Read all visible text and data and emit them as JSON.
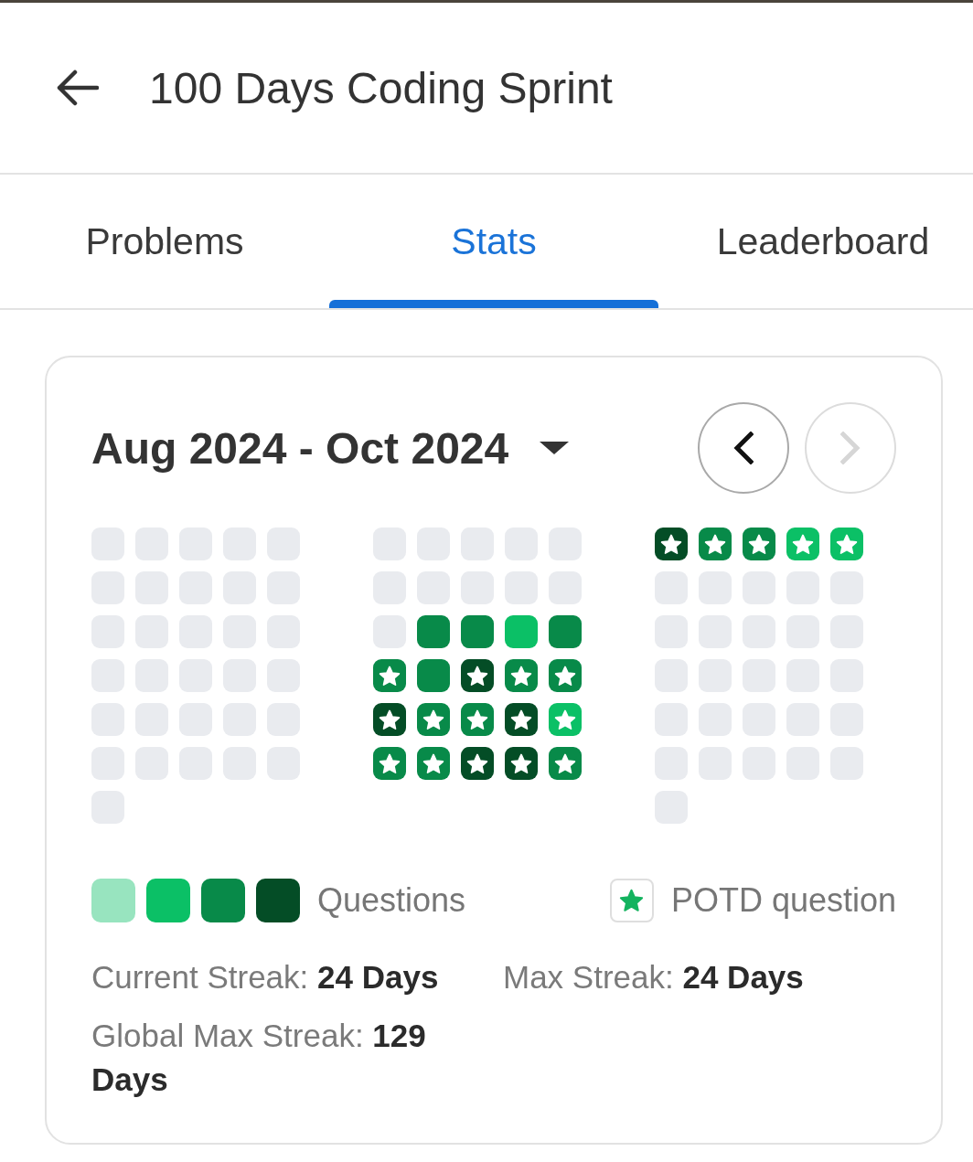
{
  "header": {
    "title": "100 Days Coding Sprint"
  },
  "tabs": [
    {
      "label": "Problems",
      "selected": false
    },
    {
      "label": "Stats",
      "selected": true
    },
    {
      "label": "Leaderboard",
      "selected": false
    }
  ],
  "calendar": {
    "range": "Aug 2024 - Oct 2024",
    "nav": [
      {
        "kind": "previous",
        "disabled": false
      },
      {
        "kind": "next",
        "disabled": true
      }
    ],
    "months": [
      {
        "days": [
          {
            "color": "#e9ebef",
            "potd": false
          },
          {
            "color": "#e9ebef",
            "potd": false
          },
          {
            "color": "#e9ebef",
            "potd": false
          },
          {
            "color": "#e9ebef",
            "potd": false
          },
          {
            "color": "#e9ebef",
            "potd": false
          },
          {
            "color": "#e9ebef",
            "potd": false
          },
          {
            "color": "#e9ebef",
            "potd": false
          },
          {
            "color": "#e9ebef",
            "potd": false
          },
          {
            "color": "#e9ebef",
            "potd": false
          },
          {
            "color": "#e9ebef",
            "potd": false
          },
          {
            "color": "#e9ebef",
            "potd": false
          },
          {
            "color": "#e9ebef",
            "potd": false
          },
          {
            "color": "#e9ebef",
            "potd": false
          },
          {
            "color": "#e9ebef",
            "potd": false
          },
          {
            "color": "#e9ebef",
            "potd": false
          },
          {
            "color": "#e9ebef",
            "potd": false
          },
          {
            "color": "#e9ebef",
            "potd": false
          },
          {
            "color": "#e9ebef",
            "potd": false
          },
          {
            "color": "#e9ebef",
            "potd": false
          },
          {
            "color": "#e9ebef",
            "potd": false
          },
          {
            "color": "#e9ebef",
            "potd": false
          },
          {
            "color": "#e9ebef",
            "potd": false
          },
          {
            "color": "#e9ebef",
            "potd": false
          },
          {
            "color": "#e9ebef",
            "potd": false
          },
          {
            "color": "#e9ebef",
            "potd": false
          },
          {
            "color": "#e9ebef",
            "potd": false
          },
          {
            "color": "#e9ebef",
            "potd": false
          },
          {
            "color": "#e9ebef",
            "potd": false
          },
          {
            "color": "#e9ebef",
            "potd": false
          },
          {
            "color": "#e9ebef",
            "potd": false
          },
          {
            "color": "#e9ebef",
            "potd": false
          }
        ]
      },
      {
        "days": [
          {
            "color": "#e9ebef",
            "potd": false
          },
          {
            "color": "#e9ebef",
            "potd": false
          },
          {
            "color": "#e9ebef",
            "potd": false
          },
          {
            "color": "#e9ebef",
            "potd": false
          },
          {
            "color": "#e9ebef",
            "potd": false
          },
          {
            "color": "#e9ebef",
            "potd": false
          },
          {
            "color": "#e9ebef",
            "potd": false
          },
          {
            "color": "#e9ebef",
            "potd": false
          },
          {
            "color": "#e9ebef",
            "potd": false
          },
          {
            "color": "#e9ebef",
            "potd": false
          },
          {
            "color": "#e9ebef",
            "potd": false
          },
          {
            "color": "#088a49",
            "potd": false
          },
          {
            "color": "#088a49",
            "potd": false
          },
          {
            "color": "#0bc066",
            "potd": false
          },
          {
            "color": "#088a49",
            "potd": false
          },
          {
            "color": "#088a49",
            "potd": true
          },
          {
            "color": "#088a49",
            "potd": false
          },
          {
            "color": "#044d26",
            "potd": true
          },
          {
            "color": "#088a49",
            "potd": true
          },
          {
            "color": "#088a49",
            "potd": true
          },
          {
            "color": "#044d26",
            "potd": true
          },
          {
            "color": "#088a49",
            "potd": true
          },
          {
            "color": "#088a49",
            "potd": true
          },
          {
            "color": "#044d26",
            "potd": true
          },
          {
            "color": "#0bc066",
            "potd": true
          },
          {
            "color": "#088a49",
            "potd": true
          },
          {
            "color": "#088a49",
            "potd": true
          },
          {
            "color": "#044d26",
            "potd": true
          },
          {
            "color": "#044d26",
            "potd": true
          },
          {
            "color": "#088a49",
            "potd": true
          }
        ]
      },
      {
        "days": [
          {
            "color": "#044d26",
            "potd": true
          },
          {
            "color": "#088a49",
            "potd": true
          },
          {
            "color": "#088a49",
            "potd": true
          },
          {
            "color": "#0bc066",
            "potd": true
          },
          {
            "color": "#0bc066",
            "potd": true
          },
          {
            "color": "#e9ebef",
            "potd": false
          },
          {
            "color": "#e9ebef",
            "potd": false
          },
          {
            "color": "#e9ebef",
            "potd": false
          },
          {
            "color": "#e9ebef",
            "potd": false
          },
          {
            "color": "#e9ebef",
            "potd": false
          },
          {
            "color": "#e9ebef",
            "potd": false
          },
          {
            "color": "#e9ebef",
            "potd": false
          },
          {
            "color": "#e9ebef",
            "potd": false
          },
          {
            "color": "#e9ebef",
            "potd": false
          },
          {
            "color": "#e9ebef",
            "potd": false
          },
          {
            "color": "#e9ebef",
            "potd": false
          },
          {
            "color": "#e9ebef",
            "potd": false
          },
          {
            "color": "#e9ebef",
            "potd": false
          },
          {
            "color": "#e9ebef",
            "potd": false
          },
          {
            "color": "#e9ebef",
            "potd": false
          },
          {
            "color": "#e9ebef",
            "potd": false
          },
          {
            "color": "#e9ebef",
            "potd": false
          },
          {
            "color": "#e9ebef",
            "potd": false
          },
          {
            "color": "#e9ebef",
            "potd": false
          },
          {
            "color": "#e9ebef",
            "potd": false
          },
          {
            "color": "#e9ebef",
            "potd": false
          },
          {
            "color": "#e9ebef",
            "potd": false
          },
          {
            "color": "#e9ebef",
            "potd": false
          },
          {
            "color": "#e9ebef",
            "potd": false
          },
          {
            "color": "#e9ebef",
            "potd": false
          },
          {
            "color": "#e9ebef",
            "potd": false
          }
        ]
      }
    ]
  },
  "legend": {
    "swatches": [
      {
        "color": "#98e4bf"
      },
      {
        "color": "#0bc066"
      },
      {
        "color": "#088a49"
      },
      {
        "color": "#044d26"
      }
    ],
    "label": "Questions",
    "potd_label": "POTD question"
  },
  "stats": [
    "Current Streak: **24 Days**",
    "Max Streak: **24 Days**",
    "Global Max Streak: **129 Days**"
  ]
}
